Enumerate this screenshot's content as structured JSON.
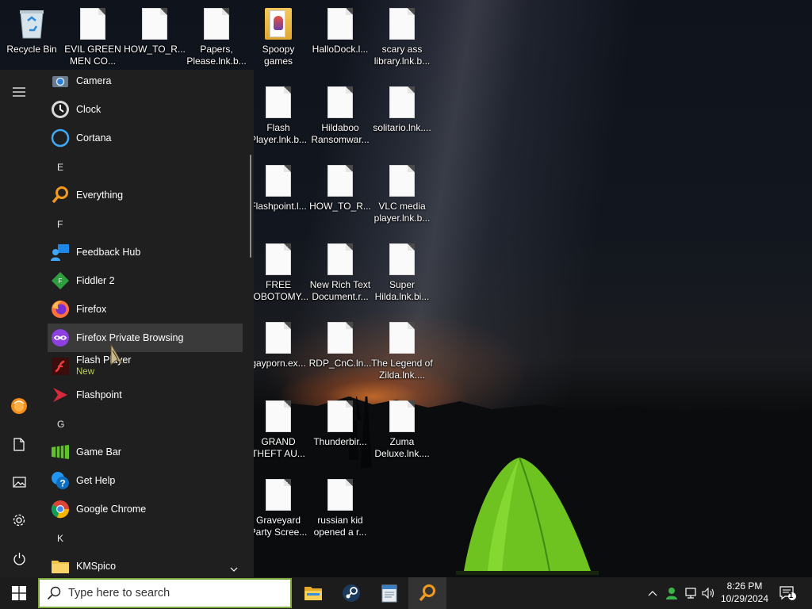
{
  "desktop": {
    "icons": [
      {
        "label": "Recycle Bin",
        "icon": "recycle-bin-icon"
      },
      {
        "label": "EVIL GREEN MEN CO...",
        "icon": "file-icon"
      },
      {
        "label": "HOW_TO_R...",
        "icon": "file-icon"
      },
      {
        "label": "Papers, Please.lnk.b...",
        "icon": "file-icon"
      },
      {
        "label": "Spoopy games",
        "icon": "folder-icon"
      },
      {
        "label": "HalloDock.l...",
        "icon": "file-icon"
      },
      {
        "label": "scary ass library.lnk.b...",
        "icon": "file-icon"
      },
      {
        "label": "Flash Player.lnk.b...",
        "icon": "file-icon"
      },
      {
        "label": "Hildaboo Ransomwar...",
        "icon": "file-icon"
      },
      {
        "label": "solitario.lnk....",
        "icon": "file-icon"
      },
      {
        "label": "Flashpoint.l...",
        "icon": "file-icon"
      },
      {
        "label": "HOW_TO_R...",
        "icon": "file-icon"
      },
      {
        "label": "VLC media player.lnk.b...",
        "icon": "file-icon"
      },
      {
        "label": "FREE LOBOTOMY...",
        "icon": "file-icon"
      },
      {
        "label": "New Rich Text Document.r...",
        "icon": "file-icon"
      },
      {
        "label": "Super Hilda.lnk.bi...",
        "icon": "file-icon"
      },
      {
        "label": "gayporn.ex...",
        "icon": "file-icon"
      },
      {
        "label": "RDP_CnC.ln...",
        "icon": "file-icon"
      },
      {
        "label": "The Legend of Zilda.lnk....",
        "icon": "file-icon"
      },
      {
        "label": "GRAND THEFT AU...",
        "icon": "file-icon"
      },
      {
        "label": "Thunderbir...",
        "icon": "file-icon"
      },
      {
        "label": "Zuma Deluxe.lnk....",
        "icon": "file-icon"
      },
      {
        "label": "Graveyard Party Scree...",
        "icon": "file-icon"
      },
      {
        "label": "russian kid opened a r...",
        "icon": "file-icon"
      }
    ]
  },
  "start_menu": {
    "apps": [
      {
        "label": "Camera",
        "icon": "camera-icon"
      },
      {
        "label": "Clock",
        "icon": "clock-icon"
      },
      {
        "label": "Cortana",
        "icon": "cortana-icon"
      },
      {
        "label": "E",
        "type": "header"
      },
      {
        "label": "Everything",
        "icon": "everything-icon"
      },
      {
        "label": "F",
        "type": "header"
      },
      {
        "label": "Feedback Hub",
        "icon": "feedback-hub-icon"
      },
      {
        "label": "Fiddler 2",
        "icon": "fiddler-icon"
      },
      {
        "label": "Firefox",
        "icon": "firefox-icon"
      },
      {
        "label": "Firefox Private Browsing",
        "icon": "firefox-private-icon"
      },
      {
        "label": "Flash Player",
        "sublabel": "New",
        "icon": "flash-player-icon"
      },
      {
        "label": "Flashpoint",
        "icon": "flashpoint-icon"
      },
      {
        "label": "G",
        "type": "header"
      },
      {
        "label": "Game Bar",
        "icon": "game-bar-icon"
      },
      {
        "label": "Get Help",
        "icon": "get-help-icon"
      },
      {
        "label": "Google Chrome",
        "icon": "chrome-icon"
      },
      {
        "label": "K",
        "type": "header"
      },
      {
        "label": "KMSpico",
        "icon": "folder-icon"
      }
    ],
    "rail": [
      "menu-icon",
      "user-avatar-icon",
      "documents-icon",
      "pictures-icon",
      "settings-icon",
      "power-icon"
    ]
  },
  "taskbar": {
    "search_placeholder": "Type here to search",
    "apps": [
      "file-explorer-icon",
      "steam-icon",
      "notepad-app-icon",
      "everything-icon"
    ],
    "time": "8:26 PM",
    "date": "10/29/2024",
    "notification_count": "1"
  },
  "colors": {
    "taskbar_bg": "#1c1c1c",
    "start_bg": "#1f1f1f",
    "search_border": "#7da83a",
    "hover": "#3a3a3a"
  }
}
